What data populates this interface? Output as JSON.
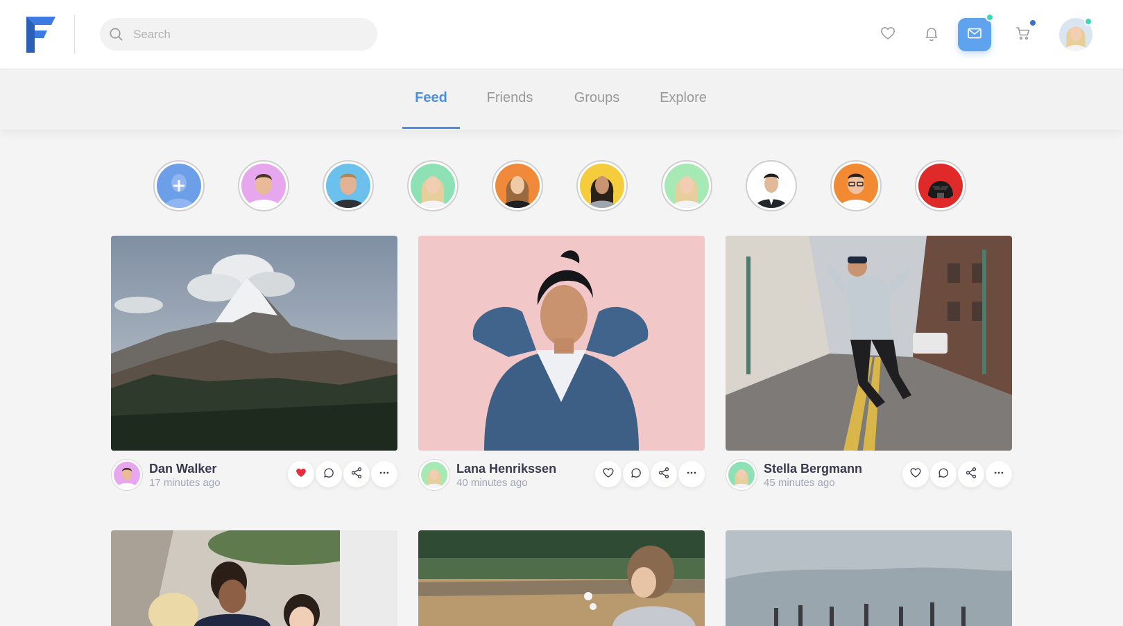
{
  "header": {
    "search_placeholder": "Search",
    "accent_color": "#4a90e2",
    "icons": [
      "heart-icon",
      "bell-icon",
      "mail-icon",
      "cart-icon"
    ]
  },
  "nav": {
    "tabs": [
      {
        "label": "Feed",
        "active": true
      },
      {
        "label": "Friends",
        "active": false
      },
      {
        "label": "Groups",
        "active": false
      },
      {
        "label": "Explore",
        "active": false
      }
    ]
  },
  "stories": [
    "add-story",
    "man-pink",
    "man-blue",
    "woman-green",
    "woman-orange",
    "woman-yellow",
    "woman-mint",
    "man-suit",
    "man-glasses",
    "dark-helmet"
  ],
  "posts": [
    {
      "author": "Dan Walker",
      "time": "17 minutes ago",
      "liked": true
    },
    {
      "author": "Lana Henrikssen",
      "time": "40 minutes ago",
      "liked": false
    },
    {
      "author": "Stella Bergmann",
      "time": "45 minutes ago",
      "liked": false
    }
  ],
  "colors": {
    "liked_heart": "#e62e3a",
    "mail_button": "#5fa2ee",
    "online_dot": "#3ed6b4",
    "cart_dot": "#3b6fc9"
  }
}
